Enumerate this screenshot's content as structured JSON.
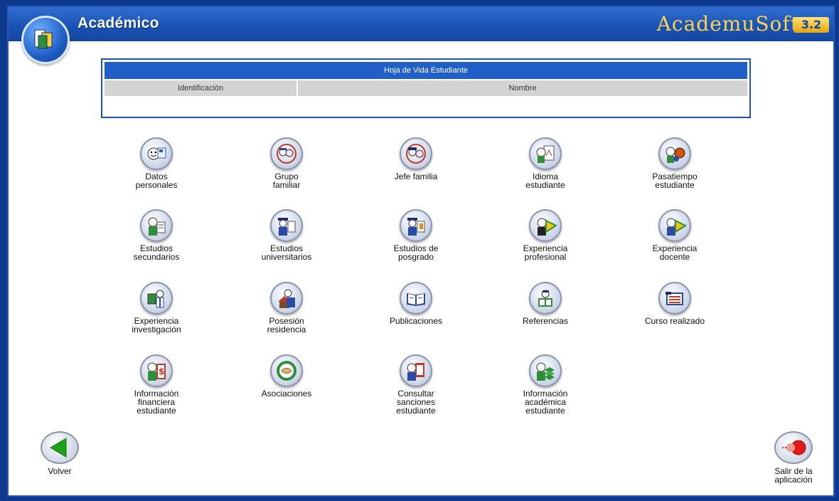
{
  "header": {
    "title": "Académico",
    "brand": "AcademuSoft",
    "version": "3.2"
  },
  "sheet": {
    "title": "Hoja de Vida Estudiante",
    "columns": [
      "Identificación",
      "Nombre"
    ]
  },
  "tiles": [
    {
      "label": "Datos\npersonales",
      "icon": "personal-data-icon"
    },
    {
      "label": "Grupo\nfamiliar",
      "icon": "family-group-icon"
    },
    {
      "label": "Jefe familia",
      "icon": "family-head-icon"
    },
    {
      "label": "Idioma\nestudiante",
      "icon": "language-icon"
    },
    {
      "label": "Pasatiempo\nestudiante",
      "icon": "hobby-icon"
    },
    {
      "label": "Estudios\nsecundarios",
      "icon": "secondary-studies-icon"
    },
    {
      "label": "Estudios\nuniversitarios",
      "icon": "university-studies-icon"
    },
    {
      "label": "Estudios de\nposgrado",
      "icon": "postgraduate-icon"
    },
    {
      "label": "Experiencia\nprofesional",
      "icon": "professional-experience-icon"
    },
    {
      "label": "Experiencia\ndocente",
      "icon": "teaching-experience-icon"
    },
    {
      "label": "Experiencia\ninvestigación",
      "icon": "research-experience-icon"
    },
    {
      "label": "Posesión\nresidencia",
      "icon": "residence-icon"
    },
    {
      "label": "Publicaciones",
      "icon": "publications-icon"
    },
    {
      "label": "Referencias",
      "icon": "references-icon"
    },
    {
      "label": "Curso realizado",
      "icon": "course-icon"
    },
    {
      "label": "Información\nfinanciera\nestudiante",
      "icon": "financial-info-icon"
    },
    {
      "label": "Asociaciones",
      "icon": "associations-icon"
    },
    {
      "label": "Consultar\nsanciones\nestudiante",
      "icon": "sanctions-icon"
    },
    {
      "label": "Información\nacadémica\nestudiante",
      "icon": "academic-info-icon"
    }
  ],
  "nav": {
    "back_label": "Volver",
    "exit_label": "Salir de la\naplicación"
  },
  "colors": {
    "frame": "#0d3a8c",
    "header": "#1f5fc7",
    "brand": "#ffd24a",
    "back_arrow": "#1aa31a",
    "exit_red": "#e01818"
  }
}
